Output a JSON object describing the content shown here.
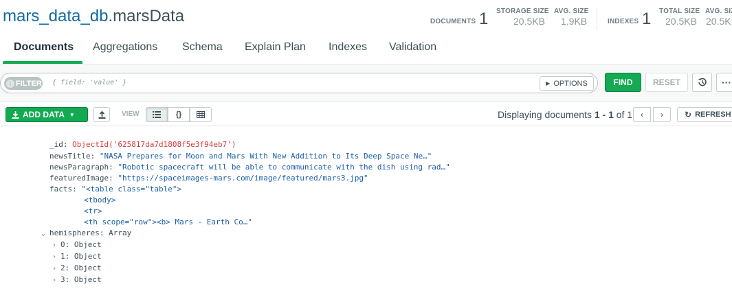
{
  "namespace": {
    "db": "mars_data_db",
    "collection": ".marsData"
  },
  "stats": {
    "documents_label": "DOCUMENTS",
    "documents_count": "1",
    "storage_size_label": "STORAGE SIZE",
    "storage_size": "20.5KB",
    "avg_size_label": "AVG. SIZE",
    "avg_size": "1.9KB",
    "indexes_label": "INDEXES",
    "indexes_count": "1",
    "total_size_label": "TOTAL SIZE",
    "total_size": "20.5KB",
    "idx_avg_size_label": "AVG. SIZ",
    "idx_avg_size": "20.5K"
  },
  "tabs": [
    {
      "label": "Documents",
      "active": true
    },
    {
      "label": "Aggregations"
    },
    {
      "label": "Schema"
    },
    {
      "label": "Explain Plan"
    },
    {
      "label": "Indexes"
    },
    {
      "label": "Validation"
    }
  ],
  "filter": {
    "pill_label": "FILTER",
    "placeholder": "{ field: 'value' }",
    "options_label": "OPTIONS",
    "find_label": "FIND",
    "reset_label": "RESET",
    "more_label": "···"
  },
  "toolbar": {
    "add_data_label": "ADD DATA",
    "view_label": "VIEW",
    "json_view_label": "{}",
    "display_prefix": "Displaying documents ",
    "display_range": "1 - 1",
    "display_of": " of ",
    "display_total": "1",
    "refresh_label": "REFRESH"
  },
  "document": {
    "id_key": "_id:",
    "id_value": "ObjectId('625817da7d1808f5e3f94eb7')",
    "newsTitle_key": "newsTitle:",
    "newsTitle_value": "\"NASA Prepares for Moon and Mars With New Addition to Its Deep Space Ne…\"",
    "newsParagraph_key": "newsParagraph:",
    "newsParagraph_value": "\"Robotic spacecraft will be able to communicate with the dish using rad…\"",
    "featuredImage_key": "featuredImage:",
    "featuredImage_value": "\"https://spaceimages-mars.com/image/featured/mars3.jpg\"",
    "facts_key": "facts:",
    "facts_line1": "\"<table class=\"table\">",
    "facts_line2": "<tbody>",
    "facts_line3": "<tr>",
    "facts_line4": "<th scope=\"row\"><b> Mars - Earth Co…\"",
    "hemispheres_key": "hemispheres:",
    "hemispheres_type": "Array",
    "items": [
      {
        "key": "0:",
        "type": "Object"
      },
      {
        "key": "1:",
        "type": "Object"
      },
      {
        "key": "2:",
        "type": "Object"
      },
      {
        "key": "3:",
        "type": "Object"
      }
    ]
  }
}
